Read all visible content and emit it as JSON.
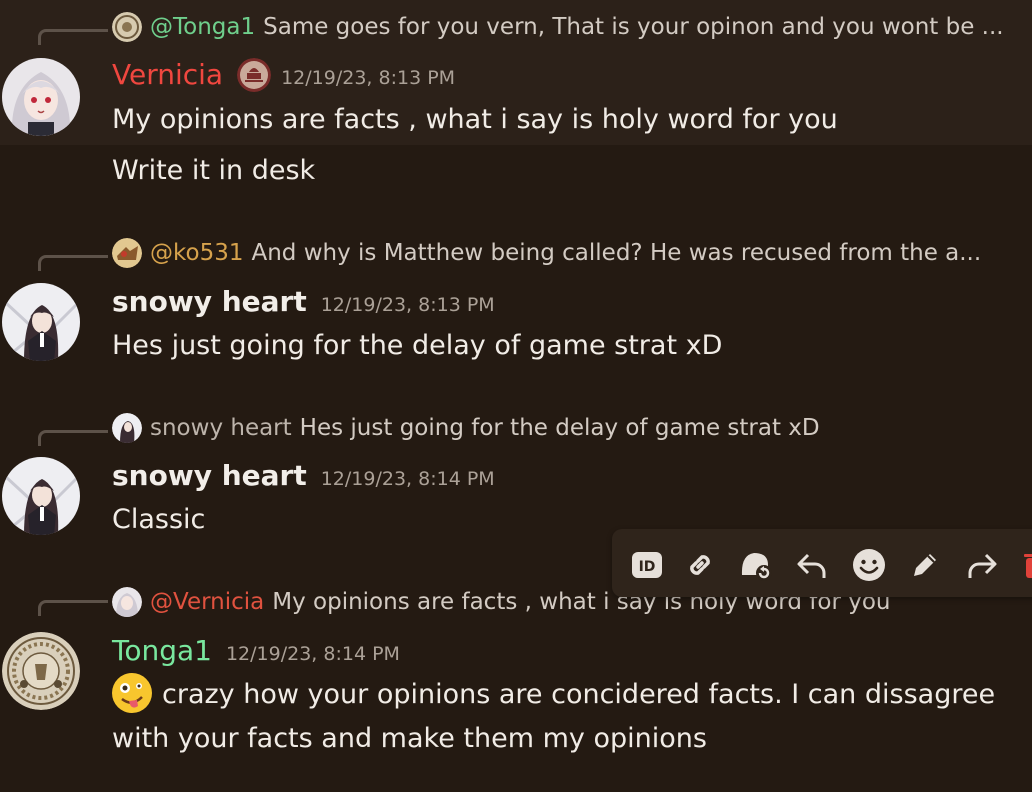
{
  "messages": [
    {
      "reply": {
        "name": "@Tonga1",
        "text": "Same goes for you vern, That is your opinon and you wont be ..."
      },
      "author": "Vernicia",
      "timestamp": "12/19/23, 8:13 PM",
      "lines": [
        "My opinions are facts , what i say is holy word for you",
        "Write it in desk"
      ]
    },
    {
      "reply": {
        "name": "@ko531",
        "text": "And why is Matthew being called? He was recused from the a..."
      },
      "author": "snowy heart",
      "timestamp": "12/19/23, 8:13 PM",
      "lines": [
        "Hes just going for the delay of game strat xD"
      ]
    },
    {
      "reply": {
        "name": "snowy heart",
        "text": "Hes just going for the delay of game strat xD"
      },
      "author": "snowy heart",
      "timestamp": "12/19/23, 8:14 PM",
      "lines": [
        "Classic"
      ]
    },
    {
      "reply": {
        "name": "@Vernicia",
        "text": "My opinions are facts , what i say is holy word for you"
      },
      "author": "Tonga1",
      "timestamp": "12/19/23, 8:14 PM",
      "lines": [
        "crazy how your opinions are concidered facts. I can dissagree",
        "with your facts and make them my opinions"
      ]
    }
  ],
  "colors": {
    "vernicia": "#f0473f",
    "snowy": "#f2eee9",
    "tonga": "#79e79e",
    "ko531": "#d6a24c",
    "tonga_reply": "#6fcf8c",
    "vernicia_reply": "#e0523f"
  },
  "icons": [
    "id-icon",
    "link-icon",
    "reaction-icon",
    "reply-icon",
    "emoji-icon",
    "edit-icon",
    "forward-icon",
    "delete-icon"
  ]
}
